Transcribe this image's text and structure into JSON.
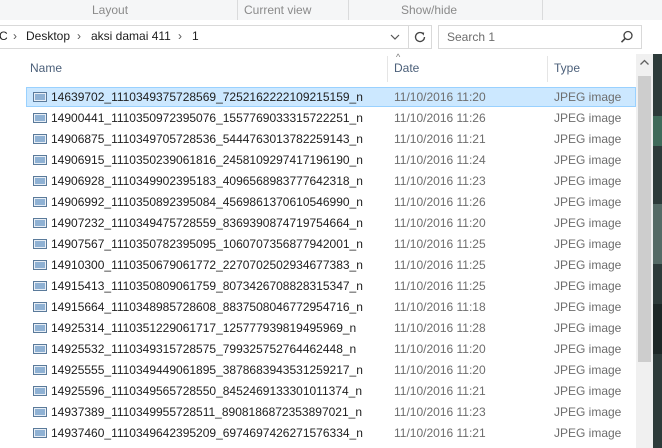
{
  "ribbon": {
    "groups": [
      "Layout",
      "Current view",
      "Show/hide"
    ]
  },
  "address": {
    "crumbs": [
      "C",
      "Desktop",
      "aksi damai 411",
      "1"
    ]
  },
  "search": {
    "placeholder": "Search 1"
  },
  "columns": {
    "name": "Name",
    "date": "Date",
    "type": "Type"
  },
  "colors": {
    "selection": "#cce8ff",
    "selection_border": "#99d1ff",
    "header_text": "#4c607a"
  },
  "files": [
    {
      "name": "14639702_1110349375728569_7252162222109215159_n",
      "date": "11/10/2016 11:20",
      "type": "JPEG image",
      "selected": true
    },
    {
      "name": "14900441_1110350972395076_1557769033315722251_n",
      "date": "11/10/2016 11:26",
      "type": "JPEG image"
    },
    {
      "name": "14906875_1110349705728536_5444763013782259143_n",
      "date": "11/10/2016 11:21",
      "type": "JPEG image"
    },
    {
      "name": "14906915_1110350239061816_2458109297417196190_n",
      "date": "11/10/2016 11:24",
      "type": "JPEG image"
    },
    {
      "name": "14906928_1110349902395183_4096568983777642318_n",
      "date": "11/10/2016 11:23",
      "type": "JPEG image"
    },
    {
      "name": "14906992_1110350892395084_4569861370610546990_n",
      "date": "11/10/2016 11:26",
      "type": "JPEG image"
    },
    {
      "name": "14907232_1110349475728559_8369390874719754664_n",
      "date": "11/10/2016 11:20",
      "type": "JPEG image"
    },
    {
      "name": "14907567_1110350782395095_1060707356877942001_n",
      "date": "11/10/2016 11:25",
      "type": "JPEG image"
    },
    {
      "name": "14910300_1110350679061772_2270702502934677383_n",
      "date": "11/10/2016 11:25",
      "type": "JPEG image"
    },
    {
      "name": "14915413_1110350809061759_8073426708828315347_n",
      "date": "11/10/2016 11:25",
      "type": "JPEG image"
    },
    {
      "name": "14915664_1110348985728608_8837508046772954716_n",
      "date": "11/10/2016 11:18",
      "type": "JPEG image"
    },
    {
      "name": "14925314_1110351229061717_1257779398194959​69_n",
      "date": "11/10/2016 11:28",
      "type": "JPEG image"
    },
    {
      "name": "14925532_1110349315728575_799325752764462448_n",
      "date": "11/10/2016 11:20",
      "type": "JPEG image"
    },
    {
      "name": "14925555_1110349449061895_3878683943531259217_n",
      "date": "11/10/2016 11:20",
      "type": "JPEG image"
    },
    {
      "name": "14925596_1110349565728550_8452469133301011374_n",
      "date": "11/10/2016 11:21",
      "type": "JPEG image"
    },
    {
      "name": "14937389_1110349955728511_8908186872353897021_n",
      "date": "11/10/2016 11:23",
      "type": "JPEG image"
    },
    {
      "name": "14937460_1110349642395209_6974697426271576334_n",
      "date": "11/10/2016 11:21",
      "type": "JPEG image"
    },
    {
      "name": "",
      "date": "",
      "type": ""
    }
  ]
}
